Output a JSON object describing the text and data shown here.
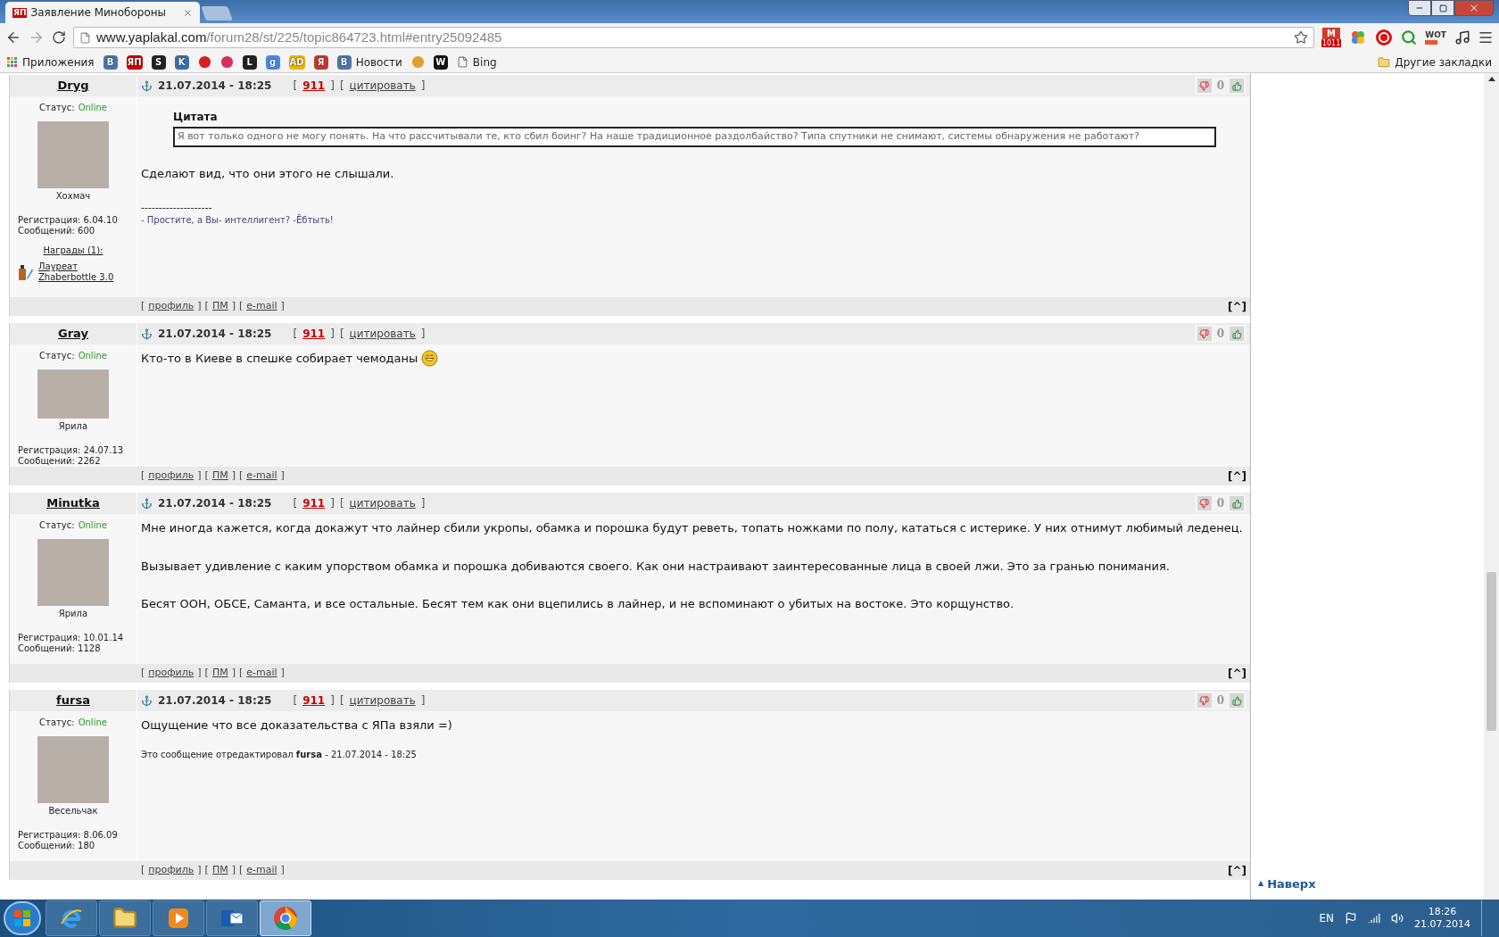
{
  "browser": {
    "tab": {
      "favicon": "ЯП",
      "title": "Заявление Минобороны"
    },
    "url": {
      "host": "www.yaplakal.com",
      "path": "/forum28/st/225/topic864723.html#entry25092485"
    },
    "extensions": [
      {
        "kind": "mail",
        "glyph": "M",
        "badge": "1011"
      },
      {
        "kind": "flower"
      },
      {
        "kind": "adblock"
      },
      {
        "kind": "search"
      },
      {
        "kind": "wot",
        "glyph": "WOT"
      },
      {
        "kind": "music"
      }
    ],
    "bookmarks": [
      {
        "kind": "apps",
        "label": "Приложения"
      },
      {
        "kind": "glyph",
        "glyph": "B",
        "color": "#4a76a8"
      },
      {
        "kind": "glyph",
        "glyph": "ЯП",
        "color": "#cc0000"
      },
      {
        "kind": "glyph",
        "glyph": "S",
        "color": "#222222"
      },
      {
        "kind": "glyph",
        "glyph": "K",
        "color": "#3b6ea5"
      },
      {
        "kind": "dot",
        "color": "#d42020"
      },
      {
        "kind": "dot",
        "color": "#d43060"
      },
      {
        "kind": "glyph",
        "glyph": "L",
        "color": "#222222"
      },
      {
        "kind": "glyph",
        "glyph": "g",
        "color": "#4a86e8"
      },
      {
        "kind": "glyph",
        "glyph": "AD",
        "color": "#e8b800"
      },
      {
        "kind": "glyph",
        "glyph": "Я",
        "color": "#c0392b"
      },
      {
        "kind": "glyph",
        "glyph": "B",
        "label": "Новости",
        "color": "#4a76a8"
      },
      {
        "kind": "dot",
        "color": "#e0a030"
      },
      {
        "kind": "glyph",
        "glyph": "W",
        "color": "#111111"
      },
      {
        "kind": "page",
        "label": "Bing"
      }
    ],
    "other_bookmarks": "Другие закладки"
  },
  "brackets": [
    "[",
    "]"
  ],
  "posts": [
    {
      "author": "Dryg",
      "status_label": "Статус:",
      "status": "Online",
      "rank": "Хохмач",
      "registered": "Регистрация: 6.04.10",
      "messages": "Сообщений: 600",
      "awards_title": "Награды (1):",
      "award": [
        "Лауреат",
        "Zhaberbottle 3.0"
      ],
      "date": "21.07.2014 - 18:25",
      "number": "911",
      "quote_link": "цитировать",
      "rating": "0",
      "body": [
        {
          "kind": "quote",
          "title": "Цитата",
          "text": "Я вот только одного не могу понять. На что рассчитывали те, кто сбил боинг? На наше традиционное раздолбайство? Типа спутники не снимают, системы обнаружения не работают?"
        },
        {
          "kind": "text",
          "text": "Сделают вид, что они этого не слышали."
        },
        {
          "kind": "signature",
          "rule": "--------------------",
          "text": "- Простите, а Вы- интеллигент? -Ёбтыть!"
        }
      ],
      "links": [
        "профиль",
        "ПМ",
        "e-mail"
      ],
      "top": "[^]"
    },
    {
      "author": "Gray",
      "status_label": "Статус:",
      "status": "Online",
      "rank": "Ярила",
      "registered": "Регистрация: 24.07.13",
      "messages": "Сообщений: 2262",
      "date": "21.07.2014 - 18:25",
      "number": "911",
      "quote_link": "цитировать",
      "rating": "0",
      "body": [
        {
          "kind": "text",
          "text": "Кто-то в Киеве в спешке собирает чемоданы",
          "smiley": true
        }
      ],
      "links": [
        "профиль",
        "ПМ",
        "e-mail"
      ],
      "top": "[^]"
    },
    {
      "author": "Minutka",
      "status_label": "Статус:",
      "status": "Online",
      "rank": "Ярила",
      "registered": "Регистрация: 10.01.14",
      "messages": "Сообщений: 1128",
      "date": "21.07.2014 - 18:25",
      "number": "911",
      "quote_link": "цитировать",
      "rating": "0",
      "body": [
        {
          "kind": "text",
          "text": "Мне иногда кажется, когда докажут что лайнер сбили укропы, обамка и порошка будут реветь, топать ножками по полу, кататься с истерике. У них отнимут любимый леденец."
        },
        {
          "kind": "text",
          "text": "Вызывает удивление с каким упорством обамка и порошка добиваются своего. Как они настраивают заинтересованные лица в своей лжи. Это за гранью понимания."
        },
        {
          "kind": "text",
          "text": "Бесят ООН, ОБСЕ, Саманта, и все остальные. Бесят тем как они вцепились в лайнер, и не вспоминают о убитых на востоке. Это корщунство."
        }
      ],
      "links": [
        "профиль",
        "ПМ",
        "e-mail"
      ],
      "top": "[^]"
    },
    {
      "author": "fursa",
      "status_label": "Статус:",
      "status": "Online",
      "rank": "Весельчак",
      "registered": "Регистрация: 8.06.09",
      "messages": "Сообщений: 180",
      "date": "21.07.2014 - 18:25",
      "number": "911",
      "quote_link": "цитировать",
      "rating": "0",
      "body": [
        {
          "kind": "text",
          "text": "Ощущение что все доказательства с ЯПа взяли =)"
        },
        {
          "kind": "edit_note",
          "text": "Это сообщение отредактировал **fursa** - 21.07.2014 - 18:25"
        }
      ],
      "links": [
        "профиль",
        "ПМ",
        "e-mail"
      ],
      "top": "[^]"
    }
  ],
  "to_top": "Наверх",
  "to_top_arrow": "▲",
  "taskbar": {
    "apps": [
      {
        "kind": "ie",
        "selected": false
      },
      {
        "kind": "folder",
        "selected": false
      },
      {
        "kind": "media",
        "selected": false
      },
      {
        "kind": "outlook",
        "selected": false
      },
      {
        "kind": "chrome",
        "selected": true
      }
    ],
    "language": "EN",
    "time": "18:26",
    "date": "21.07.2014"
  }
}
